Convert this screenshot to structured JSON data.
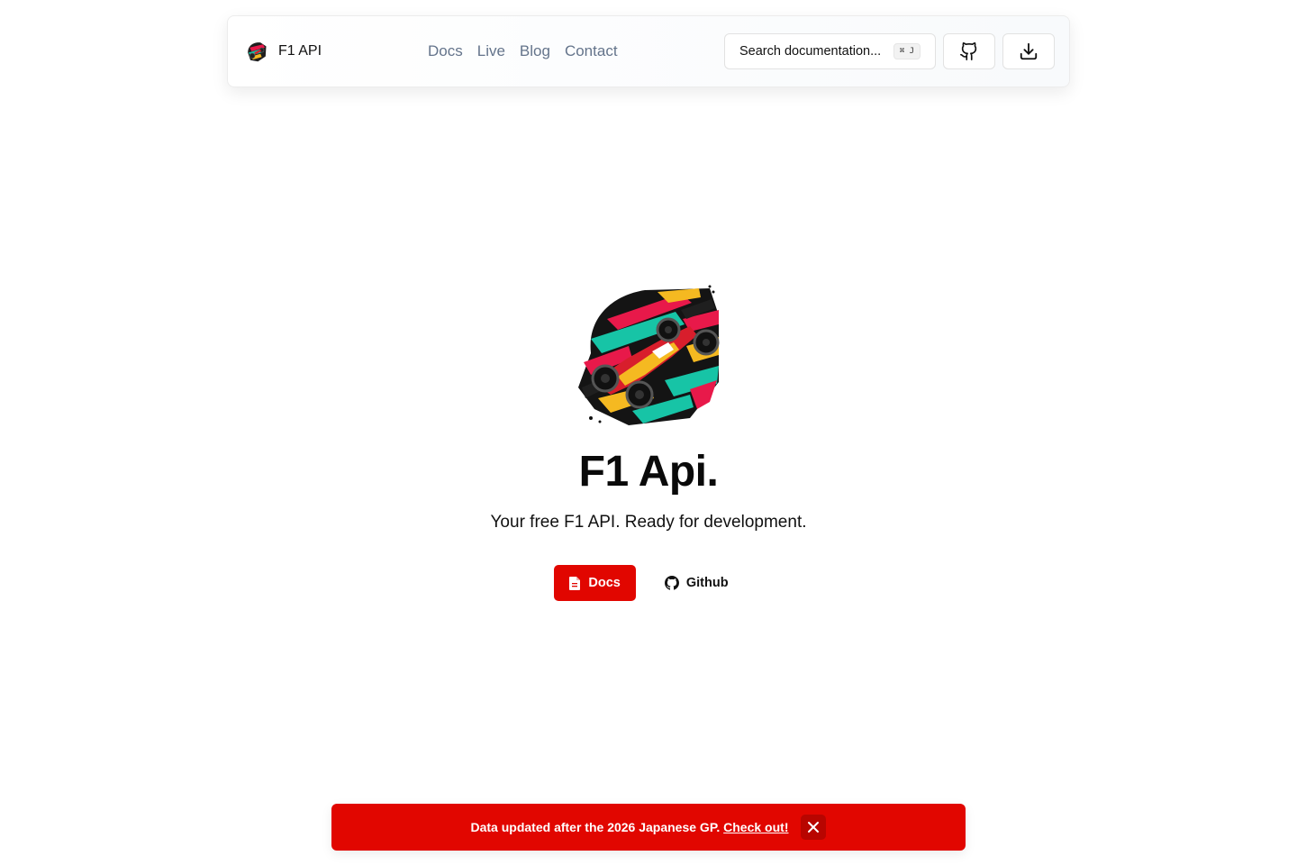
{
  "brand": {
    "name": "F1 API",
    "logo_icon": "f1-car-logo-icon"
  },
  "nav": {
    "links": [
      "Docs",
      "Live",
      "Blog",
      "Contact"
    ]
  },
  "search": {
    "label": "Search documentation...",
    "shortcut": "⌘ J"
  },
  "toolbar": {
    "github_icon": "github-icon",
    "download_icon": "download-icon"
  },
  "hero": {
    "title": "F1 Api.",
    "subtitle": "Your free F1 API. Ready for development.",
    "docs_label": "Docs",
    "github_label": "Github"
  },
  "banner": {
    "text": "Data updated after the 2026 Japanese GP.",
    "link": "Check out!",
    "close_icon": "close-icon"
  },
  "colors": {
    "accent": "#e10600",
    "nav_text": "#64748b",
    "text": "#0a0a0a"
  }
}
